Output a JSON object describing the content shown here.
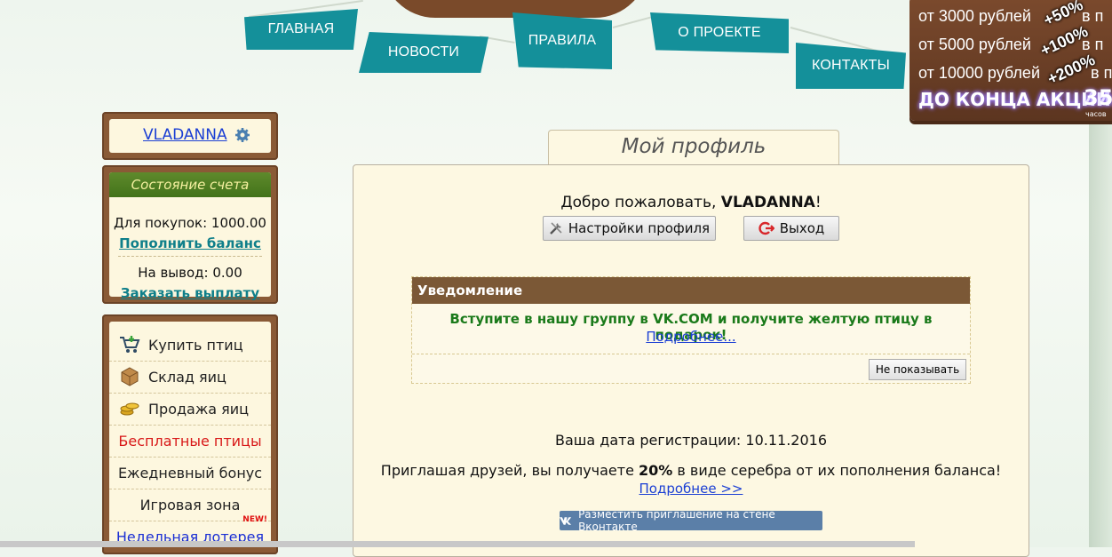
{
  "nav": [
    {
      "label": "ГЛАВНАЯ"
    },
    {
      "label": "НОВОСТИ"
    },
    {
      "label": "ПРАВИЛА"
    },
    {
      "label": "О ПРОЕКТЕ"
    },
    {
      "label": "КОНТАКТЫ"
    }
  ],
  "promo": {
    "rows": [
      "от 3000 рублей",
      "от 5000 рублей",
      "от 10000 рублей"
    ],
    "row_suffix": "в п",
    "bonuses": [
      "+50%",
      "+100%",
      "+200%"
    ],
    "deadline_label": "ДО КОНЦА АКЦИИ:",
    "timer": "35",
    "timer_unit": "часов"
  },
  "user": {
    "name": "VLADANNA",
    "settings_icon": "gear-icon"
  },
  "account": {
    "title": "Состояние счета",
    "purchase_label": "Для покупок: 1000.00",
    "topup_link": "Пополнить баланс",
    "withdraw_label": "На вывод: 0.00",
    "payout_link": "Заказать выплату"
  },
  "menu": {
    "items": [
      {
        "label": "Купить птиц",
        "icon": "cart-icon"
      },
      {
        "label": "Склад яиц",
        "icon": "box-icon"
      },
      {
        "label": "Продажа яиц",
        "icon": "coins-icon"
      },
      {
        "label": "Бесплатные птицы",
        "color": "#d81818"
      },
      {
        "label": "Ежедневный бонус"
      },
      {
        "label": "Игровая зона"
      },
      {
        "label": "Недельная лотерея",
        "color": "#1b2fd4",
        "badge": "NEW!"
      }
    ]
  },
  "main": {
    "title": "Мой профиль",
    "welcome_prefix": "Добро пожаловать, ",
    "welcome_name": "VLADANNA",
    "welcome_suffix": "!",
    "settings_button": "Настройки профиля",
    "logout_button": "Выход",
    "notice": {
      "header": "Уведомление",
      "text": "Вступите в нашу группу в VK.COM и получите желтую птицу в подарок!",
      "more_link": "Подробнее...",
      "hide_button": "Не показывать"
    },
    "registration": "Ваша дата регистрации: 10.11.2016",
    "invite_prefix": "Приглашая друзей, вы получаете ",
    "invite_percent": "20%",
    "invite_suffix": " в виде серебра от их пополнения баланса!",
    "invite_more": "Подробнее >>",
    "vk_button": "Разместить приглашение на стене Вконтакте"
  },
  "colors": {
    "nav_tag": "#14909a",
    "wood": "#8a5a36",
    "panel_bg": "#fdf7df",
    "notice_header": "#7b5836",
    "link": "#1b3fd4",
    "green_text": "#1a7a1a",
    "vk_button": "#5b7fa8"
  }
}
